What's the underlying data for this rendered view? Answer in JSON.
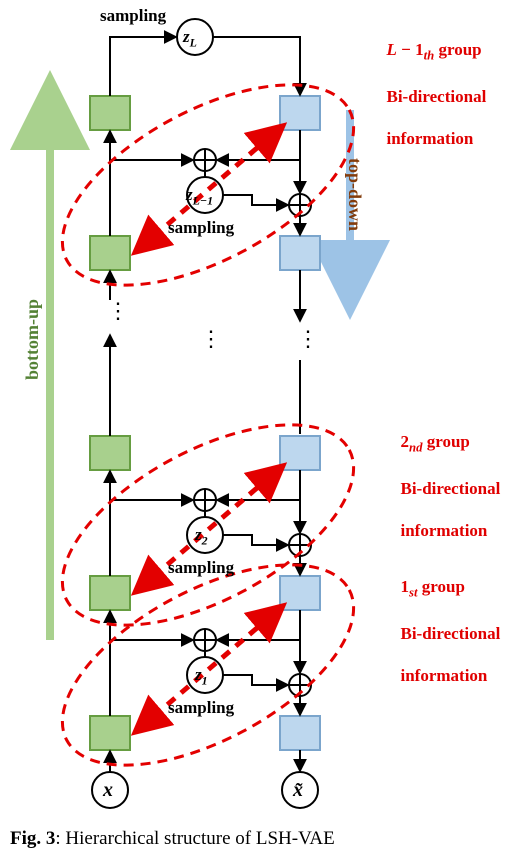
{
  "labels": {
    "sampling": "sampling",
    "bottom_up": "bottom-up",
    "top_down": "top-down",
    "groupA_line1": "L − 1_th group",
    "group_line2": "Bi-directional",
    "group_line3": "information",
    "groupB_line1": "2_nd group",
    "groupC_line1": "1_st group",
    "input": "x",
    "output": "x̃",
    "zL": "z_L",
    "zLm1": "z_{L−1}",
    "z2": "z_2",
    "z1": "z_1",
    "caption": "Fig. 3: Hierarchical structure of LSH-VAE"
  },
  "colors": {
    "encoder": "#a8d08d",
    "encoder_border": "#669d41",
    "decoder": "#bdd7ee",
    "decoder_border": "#7ba5cc",
    "group_dash": "#e30000",
    "bottom_up_arrow": "#a9d18e",
    "top_down_arrow": "#9dc3e6"
  }
}
